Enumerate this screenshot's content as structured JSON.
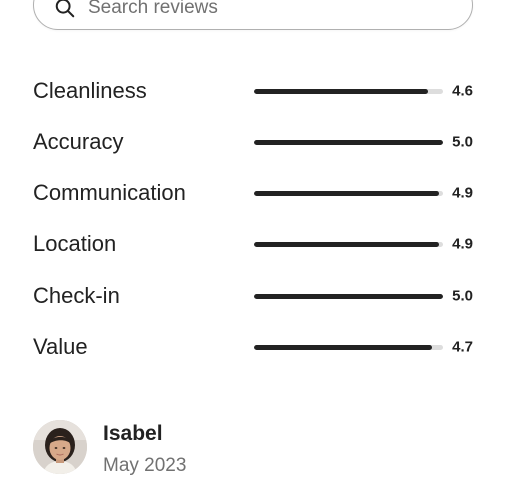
{
  "search": {
    "placeholder": "Search reviews",
    "value": ""
  },
  "ratings": [
    {
      "label": "Cleanliness",
      "score": "4.6",
      "fill_fraction": 0.92
    },
    {
      "label": "Accuracy",
      "score": "5.0",
      "fill_fraction": 1.0
    },
    {
      "label": "Communication",
      "score": "4.9",
      "fill_fraction": 0.98
    },
    {
      "label": "Location",
      "score": "4.9",
      "fill_fraction": 0.98
    },
    {
      "label": "Check-in",
      "score": "5.0",
      "fill_fraction": 1.0
    },
    {
      "label": "Value",
      "score": "4.7",
      "fill_fraction": 0.94
    }
  ],
  "review": {
    "reviewer_name": "Isabel",
    "date": "May 2023",
    "avatar": "profile-photo"
  },
  "colors": {
    "text": "#222222",
    "muted": "#717171",
    "track": "#dddddd",
    "fill": "#222222"
  }
}
